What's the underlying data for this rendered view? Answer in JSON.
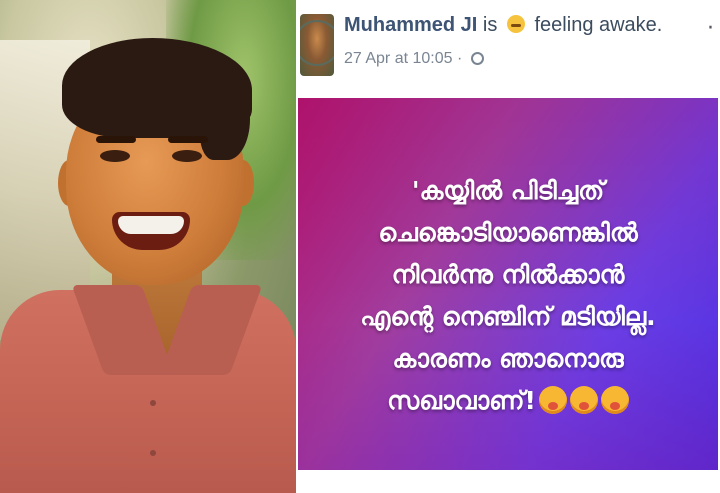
{
  "post": {
    "author": "Muhammed JI",
    "status_prefix": "is",
    "feeling": "feeling awake.",
    "timestamp": "27 Apr at 10:05 ·",
    "more": "·",
    "icons": {
      "feeling": "sleepy-emoji-icon",
      "privacy": "globe-icon",
      "reactions": "surprised-emoji-icon"
    }
  },
  "quote": {
    "lines": [
      "'കയ്യിൽ പിടിച്ചത്",
      "ചെങ്കൊടിയാണെങ്കിൽ",
      "നിവർന്നു നിൽക്കാൻ",
      "എന്റെ നെഞ്ചിന് മടിയില്ല.",
      "കാരണം ഞാനൊരു",
      "സഖാവാണ്!"
    ],
    "colors": {
      "gradient_start": "#b3126a",
      "gradient_end": "#4d2ee0",
      "text": "#ffffff"
    }
  }
}
